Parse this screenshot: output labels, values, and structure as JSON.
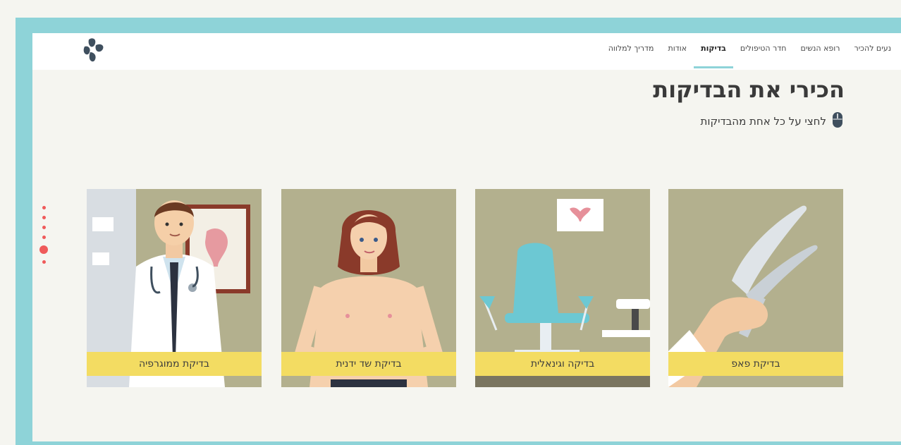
{
  "nav": {
    "items": [
      {
        "label": "נעים להכיר",
        "active": false
      },
      {
        "label": "רופא הנשים",
        "active": false
      },
      {
        "label": "חדר הטיפולים",
        "active": false
      },
      {
        "label": "בדיקות",
        "active": true
      },
      {
        "label": "אודות",
        "active": false
      },
      {
        "label": "מדריך למלווה",
        "active": false
      }
    ]
  },
  "page": {
    "title": "הכירי את הבדיקות",
    "subtitle": "לחצי על כל אחת מהבדיקות",
    "subtitle_icon": "mouse-icon"
  },
  "cards": [
    {
      "label": "בדיקת ממוגרפיה",
      "icon": "doctor-illustration"
    },
    {
      "label": "בדיקת שד ידנית",
      "icon": "woman-illustration"
    },
    {
      "label": "בדיקה וגינאלית",
      "icon": "exam-chair-illustration"
    },
    {
      "label": "בדיקת פאפ",
      "icon": "speculum-illustration"
    }
  ],
  "pager": {
    "count": 6,
    "active_index": 4
  },
  "colors": {
    "frame": "#8ed3d8",
    "accent": "#ef5a5a",
    "card_bg": "#b3b08e",
    "label_bg": "#f3dc62"
  }
}
